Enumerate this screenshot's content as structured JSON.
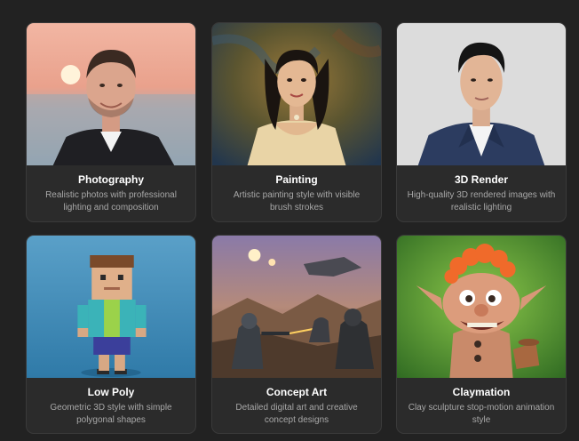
{
  "styles": [
    {
      "title": "Photography",
      "description": "Realistic photos with professional lighting and composition",
      "icon": "portrait-photo-thumbnail"
    },
    {
      "title": "Painting",
      "description": "Artistic painting style with visible brush strokes",
      "icon": "painted-portrait-thumbnail"
    },
    {
      "title": "3D Render",
      "description": "High-quality 3D rendered images with realistic lighting",
      "icon": "3d-render-portrait-thumbnail"
    },
    {
      "title": "Low Poly",
      "description": "Geometric 3D style with simple polygonal shapes",
      "icon": "low-poly-character-thumbnail"
    },
    {
      "title": "Concept Art",
      "description": "Detailed digital art and creative concept designs",
      "icon": "concept-art-battle-thumbnail"
    },
    {
      "title": "Claymation",
      "description": "Clay sculpture stop-motion animation style",
      "icon": "claymation-troll-thumbnail"
    }
  ],
  "colors": {
    "background": "#222222",
    "card": "#2b2b2b",
    "border": "#3a3a3a",
    "title": "#ffffff",
    "description": "#a8a8a8"
  }
}
